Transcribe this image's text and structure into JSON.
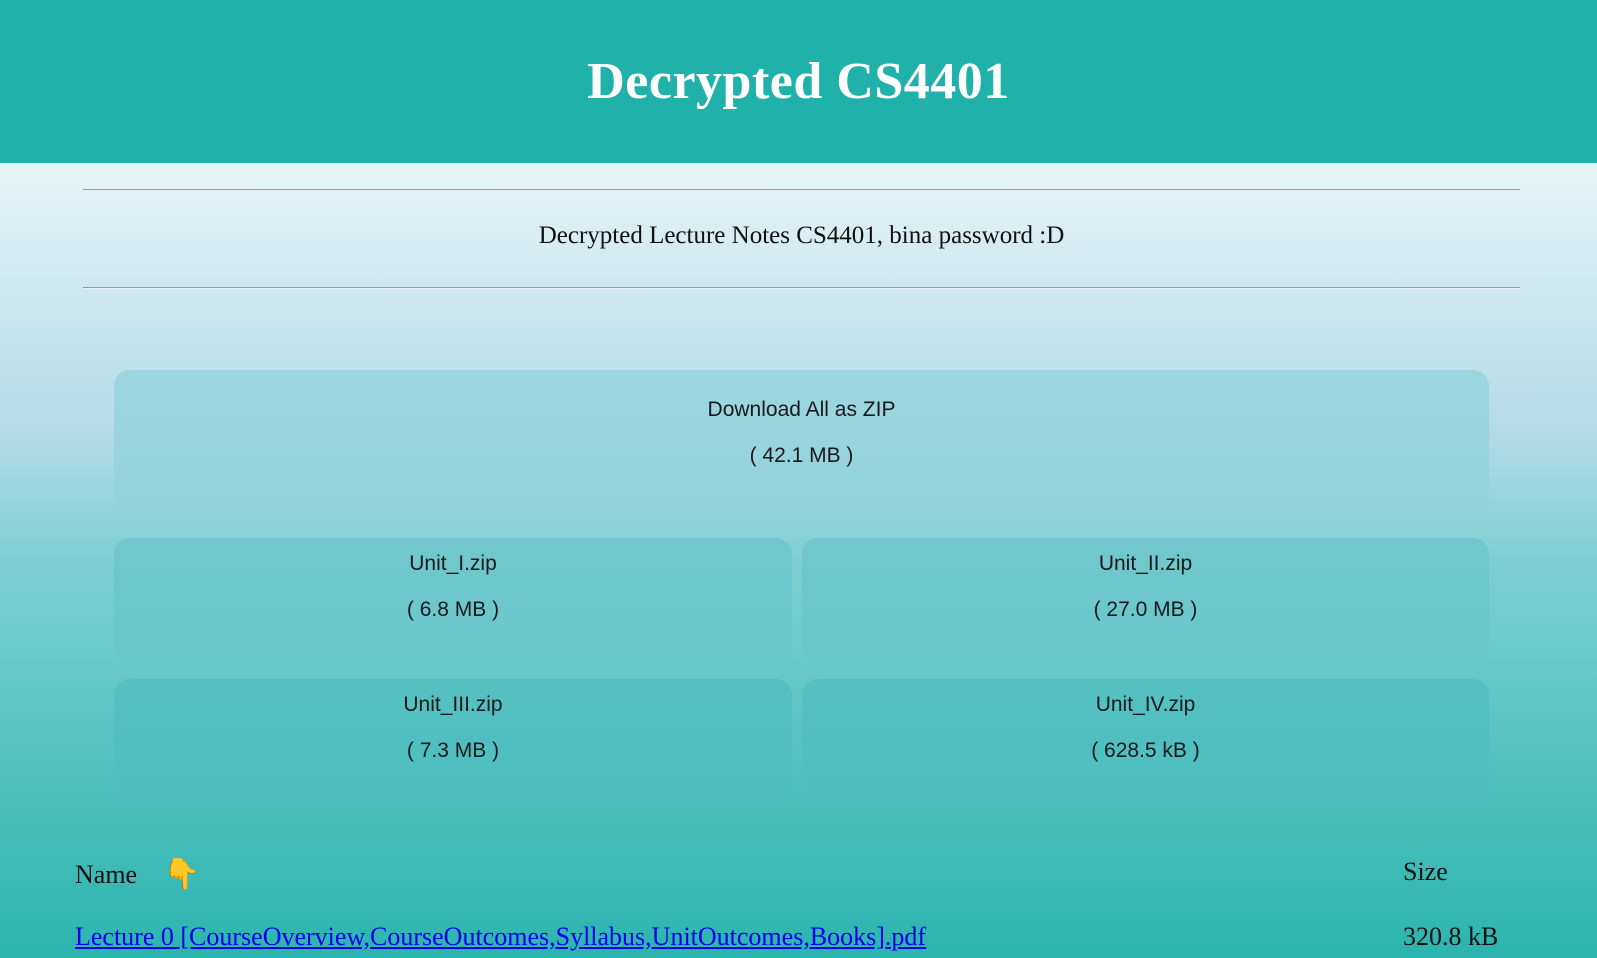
{
  "header": {
    "title": "Decrypted CS4401"
  },
  "description": "Decrypted Lecture Notes CS4401, bina password :D",
  "downloads": {
    "all": {
      "label": "Download All as ZIP",
      "size": "( 42.1 MB )"
    },
    "units": [
      {
        "label": "Unit_I.zip",
        "size": "( 6.8 MB )"
      },
      {
        "label": "Unit_II.zip",
        "size": "( 27.0 MB )"
      },
      {
        "label": "Unit_III.zip",
        "size": "( 7.3 MB )"
      },
      {
        "label": "Unit_IV.zip",
        "size": "( 628.5 kB )"
      }
    ]
  },
  "table": {
    "columns": {
      "name": "Name",
      "size": "Size"
    },
    "sort_icon": "pointing-down-hand-icon",
    "rows": [
      {
        "name": "Lecture 0 [CourseOverview,CourseOutcomes,Syllabus,UnitOutcomes,Books].pdf",
        "size": "320.8 kB"
      }
    ]
  },
  "colors": {
    "header_bg": "#20b2aa",
    "link": "#0000ee",
    "sort_icon": "#f0b323"
  }
}
